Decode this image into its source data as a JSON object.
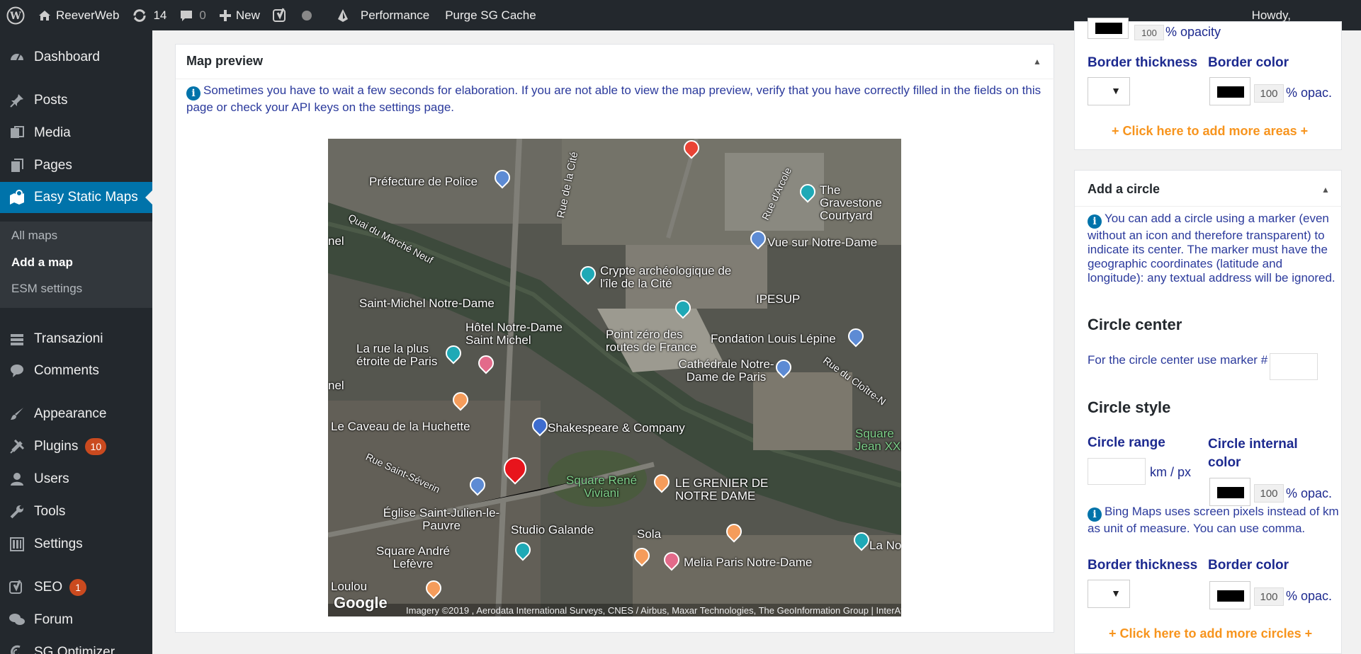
{
  "adminbar": {
    "site_name": "ReeverWeb",
    "updates_count": "14",
    "comments_count": "0",
    "new_label": "New",
    "performance_label": "Performance",
    "purge_label": "Purge SG Cache",
    "howdy": "Howdy,"
  },
  "sidebar": {
    "items": [
      {
        "label": "Dashboard"
      },
      {
        "label": "Posts"
      },
      {
        "label": "Media"
      },
      {
        "label": "Pages"
      },
      {
        "label": "Easy Static Maps"
      },
      {
        "label": "Transazioni"
      },
      {
        "label": "Comments"
      },
      {
        "label": "Appearance"
      },
      {
        "label": "Plugins",
        "badge": "10"
      },
      {
        "label": "Users"
      },
      {
        "label": "Tools"
      },
      {
        "label": "Settings"
      },
      {
        "label": "SEO",
        "badge": "1"
      },
      {
        "label": "Forum"
      },
      {
        "label": "SG Optimizer"
      }
    ],
    "submenu": [
      "All maps",
      "Add a map",
      "ESM settings"
    ]
  },
  "map_preview": {
    "title": "Map preview",
    "note": "Sometimes you have to wait a few seconds for elaboration. If you are not able to view the map preview, verify that you have correctly filled in the fields on this page or check your API keys on the settings page.",
    "attribution": "Imagery ©2019 , Aerodata International Surveys, CNES / Airbus, Maxar Technologies, The GeoInformation Group | InterAtlas",
    "google": "Google",
    "labels": {
      "prefecture": "Préfecture de Police",
      "rue_cite": "Rue de la Cité",
      "rue_arcole": "Rue d'Arcole",
      "gravestone": "The Gravestone Courtyard",
      "quai": "Quai du Marché Neuf",
      "vue_nd": "Vue sur Notre-Dame",
      "crypte": "Crypte archéologique de l'île de la Cité",
      "ipesup": "IPESUP",
      "stmichel": "Saint-Michel Notre-Dame",
      "hotel": "Hôtel Notre-Dame Saint Michel",
      "point_zero": "Point zéro des routes de France",
      "fondation": "Fondation Louis Lépine",
      "rue_plus": "La rue la plus étroite de Paris",
      "cathedrale": "Cathédrale Notre-Dame de Paris",
      "rue_cloitre": "Rue du Cloître-N",
      "caveau": "Le Caveau de la Huchette",
      "shakespeare": "Shakespeare & Company",
      "square_jean": "Square Jean XXI",
      "rue_severin": "Rue Saint-Séverin",
      "square_rene": "Square René Viviani",
      "grenier": "LE GRENIER DE NOTRE DAME",
      "eglise": "Église Saint-Julien-le-Pauvre",
      "studio": "Studio Galande",
      "sola": "Sola",
      "square_andre": "Square André Lefèvre",
      "melia": "Melia Paris Notre-Dame",
      "la_no": "La No",
      "loulou": "Loulou",
      "nel1": "nel",
      "nel2": "nel"
    }
  },
  "areas_panel": {
    "opacity_value": "100",
    "opacity_label": "% opacity",
    "border_thickness": "Border thickness",
    "border_color": "Border color",
    "opac_value": "100",
    "opac_label": "% opac.",
    "add_more": "+ Click here to add more areas +"
  },
  "circle_panel": {
    "title": "Add a circle",
    "note": "You can add a circle using a marker (even without an icon and therefore transparent) to indicate its center. The marker must have the geographic coordinates (latitude and longitude): any textual address will be ignored.",
    "center_heading": "Circle center",
    "center_label": "For the circle center use marker #",
    "style_heading": "Circle style",
    "range_label": "Circle range",
    "range_unit": "km / px",
    "internal_color_label": "Circle internal color",
    "opac_value": "100",
    "opac_label": "% opac.",
    "bing_note": "Bing Maps uses screen pixels instead of km as unit of measure. You can use comma.",
    "border_thickness": "Border thickness",
    "border_color": "Border color",
    "opac_value2": "100",
    "add_more": "+ Click here to add more circles +"
  },
  "colors": {
    "accent": "#0073aa",
    "label_blue": "#1d2a8f",
    "orange": "#f7941d",
    "badge": "#ca4a1f"
  }
}
